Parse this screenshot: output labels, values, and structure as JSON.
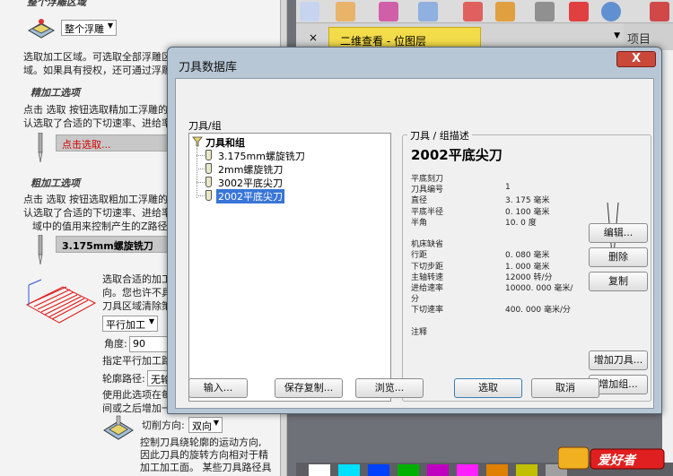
{
  "left_panel": {
    "top_section_title": "整个浮雕区域",
    "whole_relief_combo": "整个浮雕",
    "select_text_1": "选取加工区域。可选取全部浮雕区",
    "select_text_2": "域。如果具有授权，还可通过浮雕",
    "finish_title": "精加工选项",
    "finish_text_1": "点击 选取 按钮选取精加工浮雕的",
    "finish_text_2": "认选取了合适的下切速率、进给率",
    "finish_select_bar": "点击选取...",
    "rough_title": "粗加工选项",
    "rough_text_1": "点击 选取 按钮选取粗加工浮雕的",
    "rough_text_2": "认选取了合适的下切速率、进给率",
    "rough_text_3": "域中的值用来控制产生的Z路径",
    "rough_tool_bar": "3.175mm螺旋铣刀",
    "strategy_text_1": "选取合适的加工",
    "strategy_text_2": "向。您也许不具",
    "strategy_text_3": "刀具区域清除策",
    "strategy_combo": "平行加工",
    "angle_label": "角度:",
    "angle_value": "90",
    "angle_note": "指定平行加工路",
    "contour_label": "轮廓路径:",
    "contour_combo": "无轮",
    "contour_note_1": "使用此选项在每",
    "contour_note_2": "间或之后增加一",
    "cut_dir_label": "切削方向:",
    "cut_dir_combo": "双向",
    "cut_dir_note_1": "控制刀具绕轮廓的运动方向,",
    "cut_dir_note_2": "因此刀具的旋转方向相对于精",
    "cut_dir_note_3": "加工加工面。 某些刀具路径具"
  },
  "tabs": {
    "close": "×",
    "active_tab": "二维查看 - 位图层",
    "project": "项目"
  },
  "dialog": {
    "title": "刀具数据库",
    "close_label": "X",
    "group_label": "刀具/组",
    "tree": {
      "root": "刀具和组",
      "items": [
        "3.175mm螺旋铣刀",
        "2mm螺旋铣刀",
        "3002平底尖刀",
        "2002平底尖刀"
      ],
      "selected_index": 3
    },
    "desc_legend": "刀具 / 组描述",
    "tool_name": "2002平底尖刀",
    "params": [
      {
        "label": "平底刻刀",
        "value": ""
      },
      {
        "label": "刀具编号",
        "value": "1"
      },
      {
        "label": "直径",
        "value": "3. 175  毫米"
      },
      {
        "label": "平底半径",
        "value": "0. 100  毫米"
      },
      {
        "label": "半角",
        "value": "10. 0  度"
      },
      {
        "label": "",
        "value": ""
      },
      {
        "label": "机床缺省",
        "value": ""
      },
      {
        "label": "行距",
        "value": "0. 080  毫米"
      },
      {
        "label": "下切步距",
        "value": "1. 000  毫米"
      },
      {
        "label": "主轴转速",
        "value": "12000  转/分"
      },
      {
        "label": "进给速率",
        "value": "10000. 000  毫米/"
      },
      {
        "label": "分",
        "value": ""
      },
      {
        "label": "下切速率",
        "value": "400. 000  毫米/分"
      },
      {
        "label": "",
        "value": ""
      },
      {
        "label": "注释",
        "value": ""
      }
    ],
    "buttons": {
      "edit": "编辑...",
      "delete": "删除",
      "copy": "复制",
      "add_tool": "增加刀具...",
      "add_group": "增加组...",
      "import": "输入...",
      "save_copy": "保存复制...",
      "browse": "浏览...",
      "select": "选取",
      "cancel": "取消"
    }
  },
  "watermark": "爱好者",
  "colors": {
    "active_tab": "#f3dc4a",
    "tree_selection": "#3875d7",
    "dialog_frame": "#b7c7d6",
    "finish_select_text": "#d00000",
    "palette": [
      "#ffffff",
      "#00e0ff",
      "#0040ff",
      "#00b000",
      "#c000c0",
      "#ff20ff",
      "#e08000",
      "#c0c000",
      "#a0a0a0"
    ]
  }
}
